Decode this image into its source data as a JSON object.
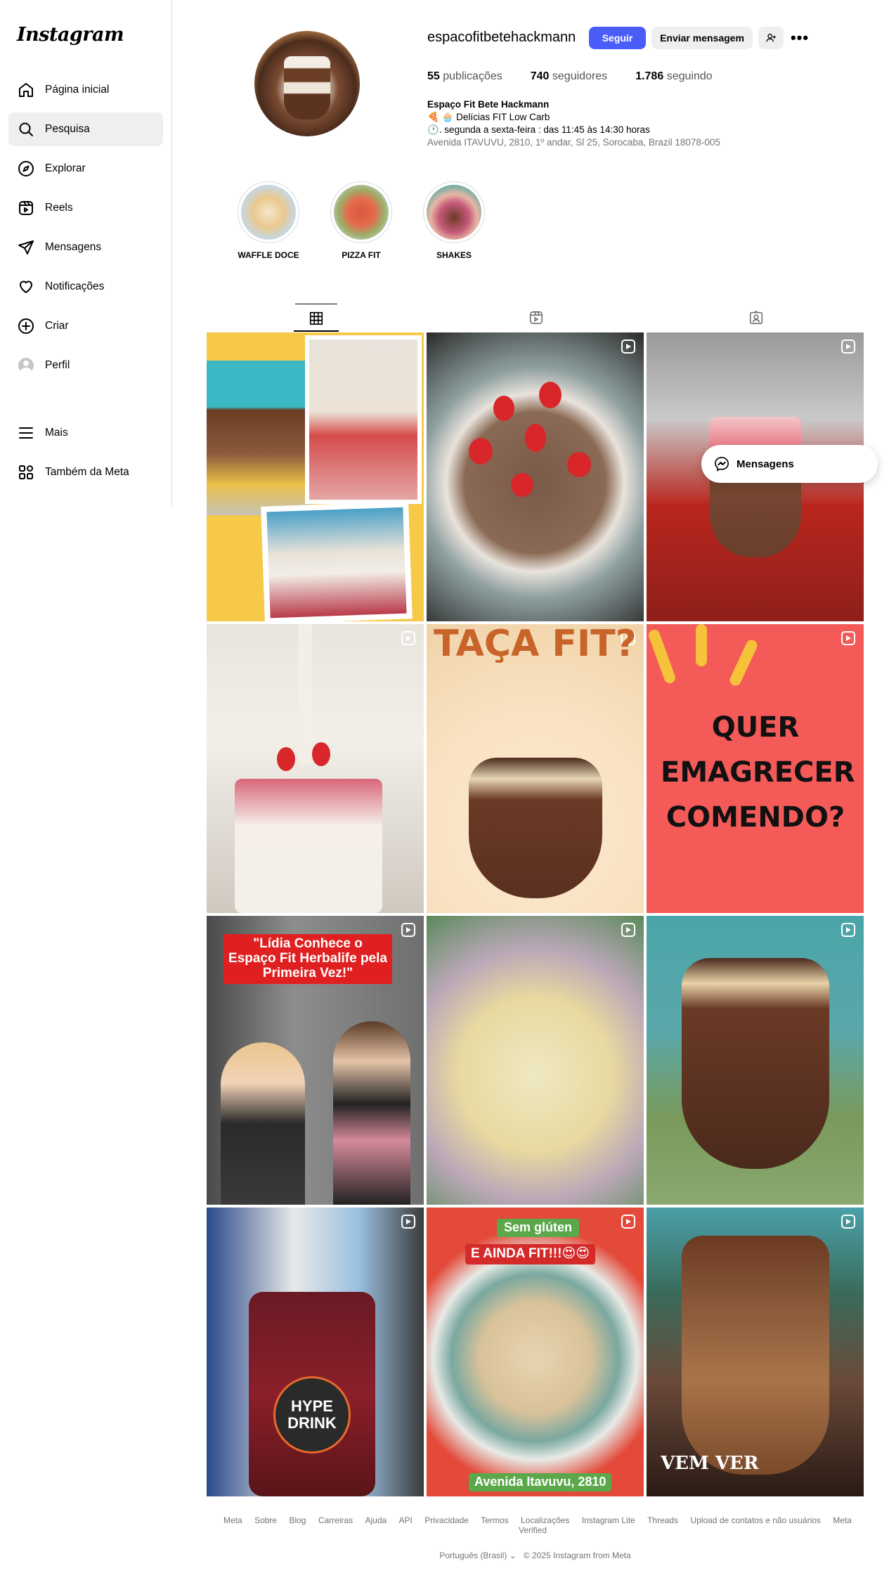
{
  "brand": {
    "logo_text": "Instagram"
  },
  "sidebar": {
    "items": [
      {
        "label": "Página inicial",
        "icon": "home-icon"
      },
      {
        "label": "Pesquisa",
        "icon": "search-icon"
      },
      {
        "label": "Explorar",
        "icon": "compass-icon"
      },
      {
        "label": "Reels",
        "icon": "reels-icon"
      },
      {
        "label": "Mensagens",
        "icon": "send-icon"
      },
      {
        "label": "Notificações",
        "icon": "heart-icon"
      },
      {
        "label": "Criar",
        "icon": "plus-square-icon"
      },
      {
        "label": "Perfil",
        "icon": "avatar-icon"
      },
      {
        "label": "Mais",
        "icon": "menu-icon"
      },
      {
        "label": "Também da Meta",
        "icon": "meta-grid-icon"
      }
    ]
  },
  "profile": {
    "username": "espacofitbetehackmann",
    "follow_label": "Seguir",
    "message_label": "Enviar mensagem",
    "more_label": "•••",
    "stats": {
      "posts_value": "55",
      "posts_label": "publicações",
      "followers_value": "740",
      "followers_label": "seguidores",
      "following_value": "1.786",
      "following_label": "seguindo"
    },
    "bio": {
      "name": "Espaço Fit Bete Hackmann",
      "line1": "🍕 🧁 Delícias FIT Low Carb",
      "line2": "🕐. segunda a sexta-feira : das 11:45 às 14:30 horas",
      "address": "Avenida ITAVUVU, 2810, 1º andar, Sl 25, Sorocaba, Brazil 18078-005"
    }
  },
  "highlights": [
    {
      "label": "WAFFLE DOCE"
    },
    {
      "label": "PIZZA FIT"
    },
    {
      "label": "SHAKES"
    }
  ],
  "tabs": [
    {
      "name": "posts",
      "icon": "grid-icon"
    },
    {
      "name": "reels",
      "icon": "reels-icon"
    },
    {
      "name": "tagged",
      "icon": "tagged-icon"
    }
  ],
  "posts": {
    "p5_text": "TAÇA FIT?",
    "p6_text": "QUER EMAGRECER COMENDO?",
    "p7_text": "\"Lídia Conhece o Espaço Fit Herbalife pela Primeira Vez!\"",
    "p10_text": "HYPE DRINK",
    "p11_top": "Sem glúten",
    "p11_mid": "E AINDA FIT!!!😍😍",
    "p11_bottom": "Avenida Itavuvu, 2810",
    "p12_text": "VEM VER"
  },
  "messages_popup": {
    "label": "Mensagens"
  },
  "footer": {
    "links": [
      "Meta",
      "Sobre",
      "Blog",
      "Carreiras",
      "Ajuda",
      "API",
      "Privacidade",
      "Termos",
      "Localizações",
      "Instagram Lite",
      "Threads",
      "Upload de contatos e não usuários",
      "Meta Verified"
    ],
    "language": "Português (Brasil)",
    "copyright": "© 2025 Instagram from Meta"
  }
}
